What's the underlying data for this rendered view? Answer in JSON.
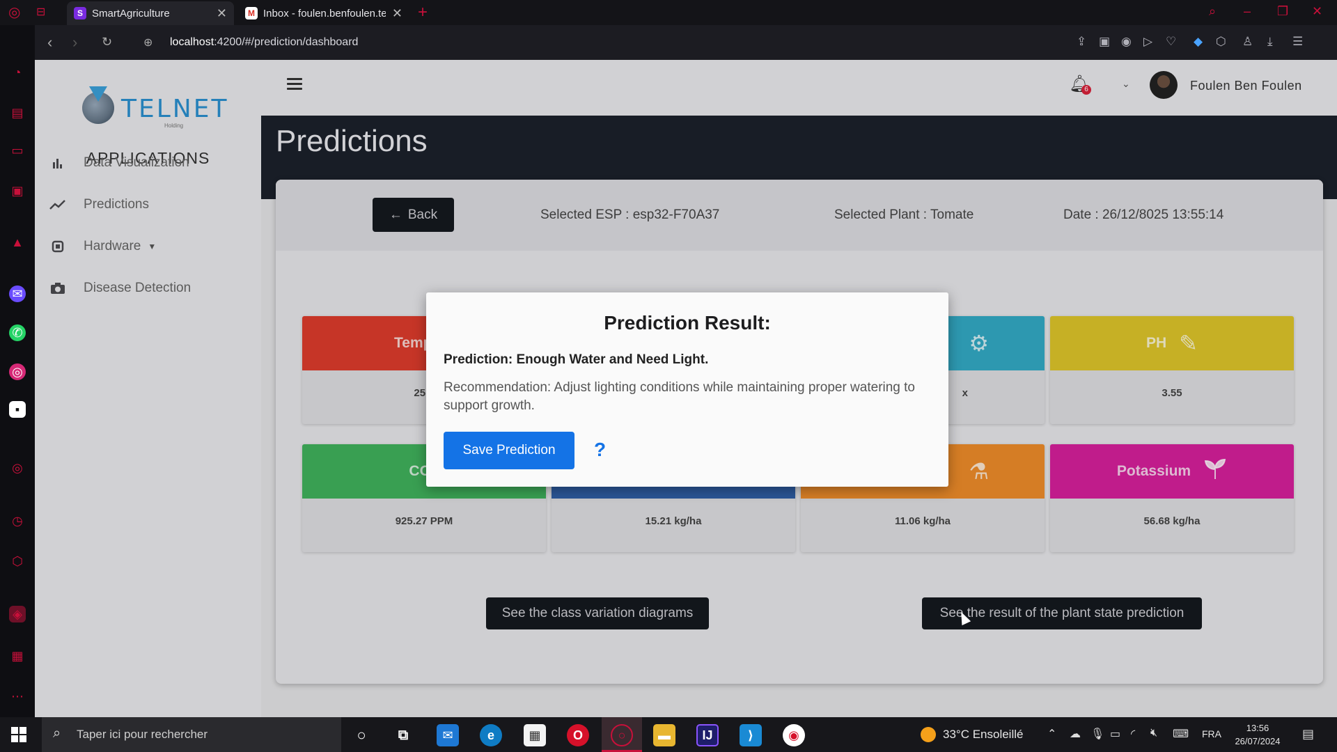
{
  "browser": {
    "tabs": [
      {
        "label": "SmartAgriculture",
        "active": true
      },
      {
        "label": "Inbox - foulen.benfoulen.te",
        "active": false
      }
    ],
    "url_host": "localhost",
    "url_rest": ":4200/#/prediction/dashboard"
  },
  "sidebar": {
    "logo_text": "TELNET",
    "logo_sub": "Holding",
    "heading": "APPLICATIONS",
    "items": [
      {
        "label": "Data Visualization",
        "icon": "bar-chart-icon"
      },
      {
        "label": "Predictions",
        "icon": "trend-line-icon"
      },
      {
        "label": "Hardware",
        "icon": "chip-icon",
        "has_caret": true
      },
      {
        "label": "Disease Detection",
        "icon": "camera-icon"
      }
    ]
  },
  "topbar": {
    "notification_count": "6",
    "user_name": "Foulen Ben Foulen"
  },
  "page": {
    "title": "Predictions"
  },
  "card": {
    "back_label": "Back",
    "selected_esp": "Selected ESP : esp32-F70A37",
    "selected_plant": "Selected Plant : Tomate",
    "date": "Date : 26/12/8025 13:55:14"
  },
  "tiles": [
    {
      "label": "Tempera",
      "value": "25.6",
      "color": "#dd3b2c",
      "icon": ""
    },
    {
      "label": "",
      "value": "",
      "color": "#e9a42a",
      "icon": ""
    },
    {
      "label": "",
      "value": "x",
      "color": "#33aac4",
      "icon": "gear-icon"
    },
    {
      "label": "PH",
      "value": "3.55",
      "color": "#ddc42a",
      "icon": "eyedropper-icon"
    },
    {
      "label": "CO2",
      "value": "925.27 PPM",
      "color": "#40b25c",
      "icon": ""
    },
    {
      "label": "",
      "value": "15.21 kg/ha",
      "color": "#2f5fa6",
      "icon": ""
    },
    {
      "label": "",
      "value": "11.06 kg/ha",
      "color": "#ee8c2a",
      "icon": "flask-icon"
    },
    {
      "label": "Potassium",
      "value": "56.68 kg/ha",
      "color": "#d6209b",
      "icon": "sprout-icon"
    }
  ],
  "buttons": {
    "class_variation": "See the class variation diagrams",
    "plant_state": "See the result of the plant state prediction"
  },
  "modal": {
    "title": "Prediction Result:",
    "prediction": "Prediction: Enough Water and Need Light.",
    "recommendation": "Recommendation: Adjust lighting conditions while maintaining proper watering to support growth.",
    "save_label": "Save Prediction",
    "help_symbol": "?"
  },
  "taskbar": {
    "search_placeholder": "Taper ici pour rechercher",
    "weather": "33°C  Ensoleillé",
    "language": "FRA",
    "time": "13:56",
    "date": "26/07/2024"
  },
  "colors": {
    "accent": "#1473e6",
    "dark_button": "#15191f",
    "header_band": "#1b212b",
    "browser_accent": "#c8103a"
  }
}
